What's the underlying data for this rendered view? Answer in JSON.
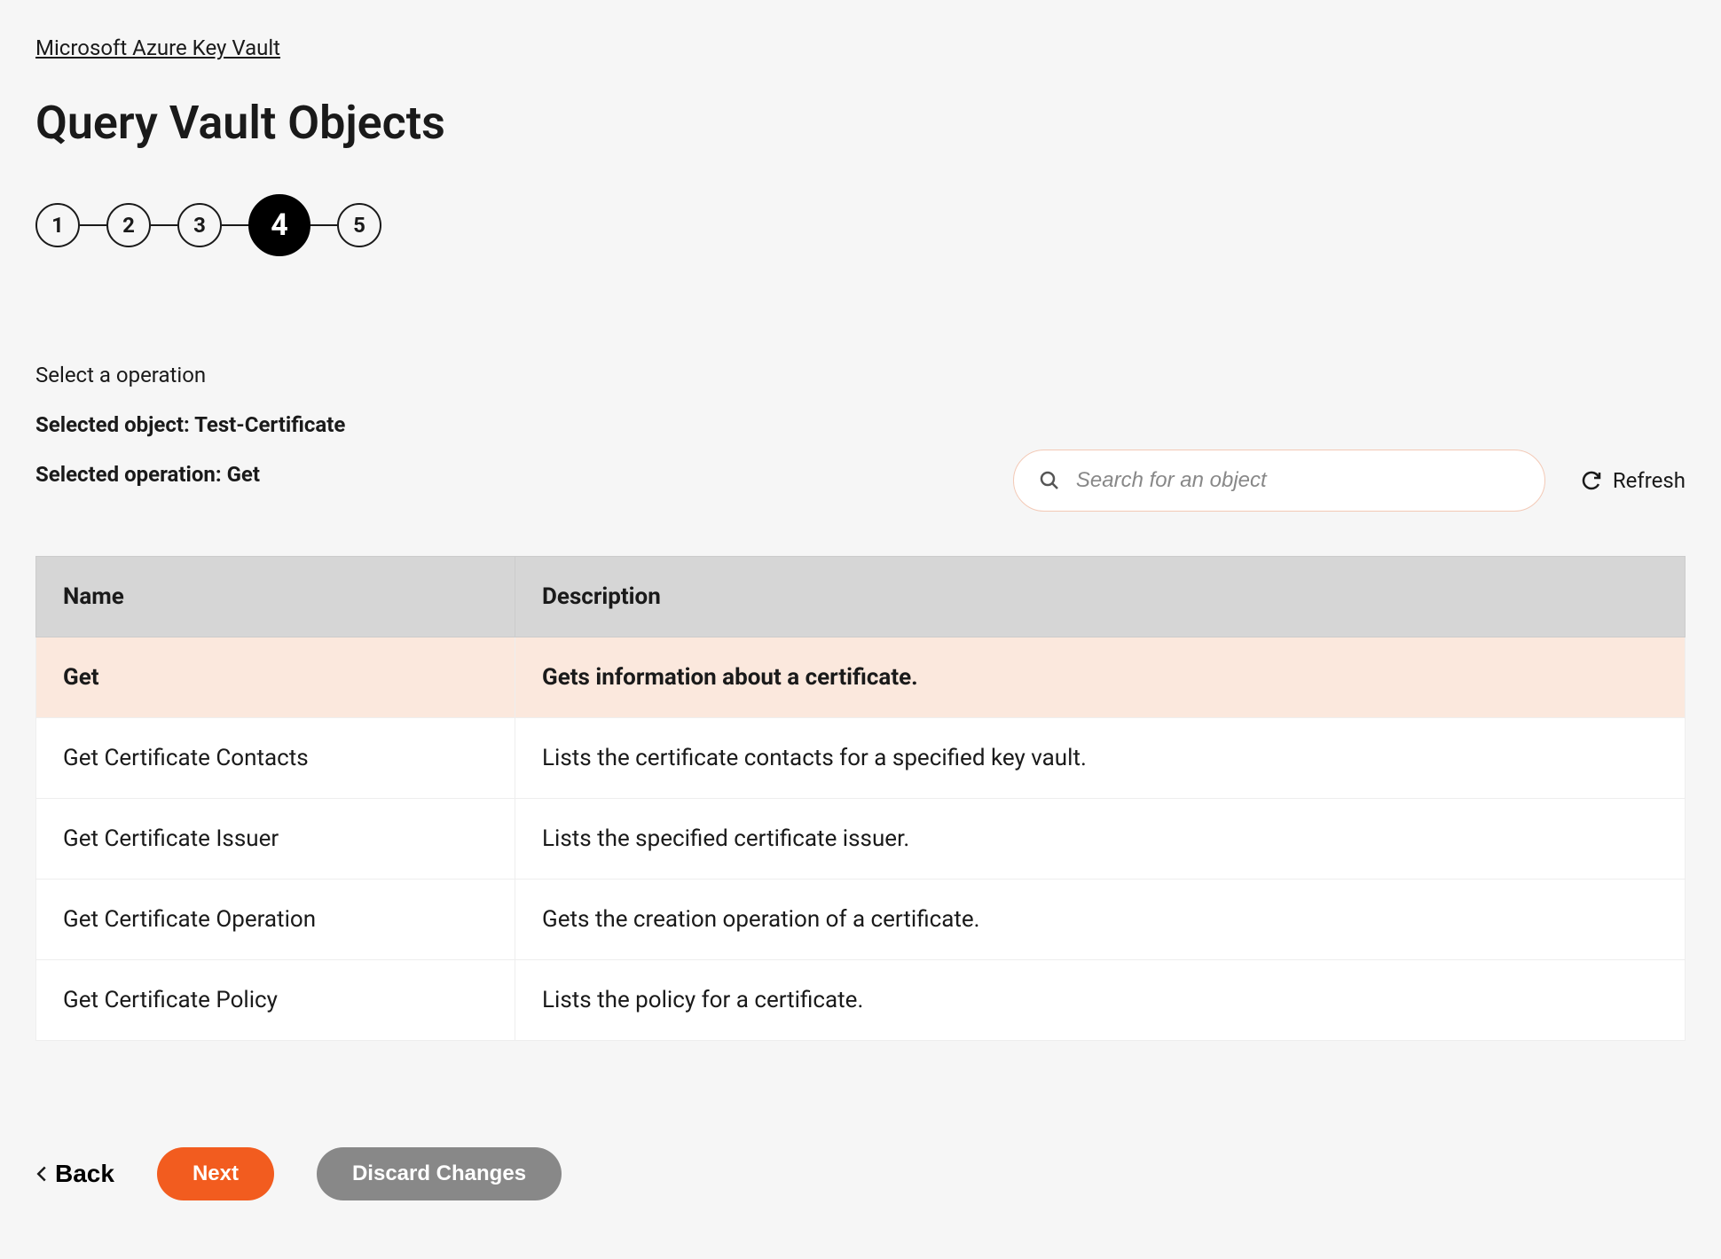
{
  "breadcrumb": "Microsoft Azure Key Vault",
  "page_title": "Query Vault Objects",
  "stepper": {
    "steps": [
      "1",
      "2",
      "3",
      "4",
      "5"
    ],
    "active_index": 3
  },
  "instruction": "Select a operation",
  "selected_object_label": "Selected object: Test-Certificate",
  "selected_operation_label": "Selected operation: Get",
  "search": {
    "placeholder": "Search for an object"
  },
  "refresh_label": "Refresh",
  "table": {
    "headers": [
      "Name",
      "Description"
    ],
    "rows": [
      {
        "name": "Get",
        "desc": "Gets information about a certificate.",
        "selected": true
      },
      {
        "name": "Get Certificate Contacts",
        "desc": "Lists the certificate contacts for a specified key vault.",
        "selected": false
      },
      {
        "name": "Get Certificate Issuer",
        "desc": "Lists the specified certificate issuer.",
        "selected": false
      },
      {
        "name": "Get Certificate Operation",
        "desc": "Gets the creation operation of a certificate.",
        "selected": false
      },
      {
        "name": "Get Certificate Policy",
        "desc": "Lists the policy for a certificate.",
        "selected": false
      }
    ]
  },
  "buttons": {
    "back": "Back",
    "next": "Next",
    "discard": "Discard Changes"
  }
}
